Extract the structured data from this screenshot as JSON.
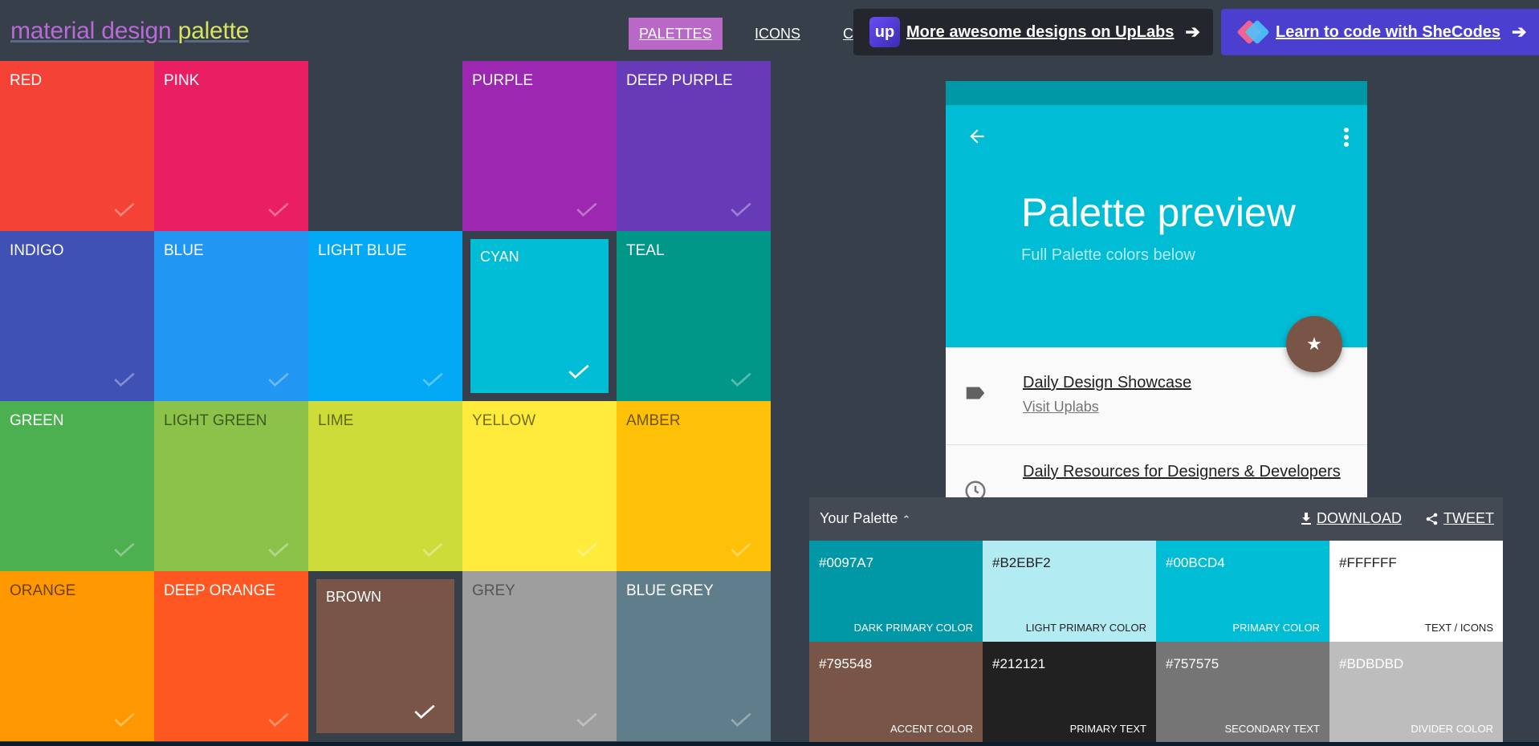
{
  "header": {
    "logo_part1": "material design",
    "logo_part2": "palette",
    "nav": [
      "PALETTES",
      "ICONS",
      "COLORS"
    ],
    "ads": {
      "uplabs_logo": "up",
      "uplabs_text": "More awesome designs on UpLabs",
      "shecodes_text": "Learn to code with SheCodes"
    }
  },
  "colors": [
    {
      "name": "RED",
      "bg": "#f44336",
      "text": "#ffffff",
      "selected": false
    },
    {
      "name": "PINK",
      "bg": "#e91e63",
      "text": "#ffffff",
      "selected": false
    },
    {
      "name": "",
      "bg": "#37404a",
      "text": "#ffffff",
      "selected": false,
      "empty": true
    },
    {
      "name": "PURPLE",
      "bg": "#9c27b0",
      "text": "#ffffff",
      "selected": false
    },
    {
      "name": "DEEP PURPLE",
      "bg": "#673ab7",
      "text": "#ffffff",
      "selected": false
    },
    {
      "name": "INDIGO",
      "bg": "#3f51b5",
      "text": "#ffffff",
      "selected": false
    },
    {
      "name": "BLUE",
      "bg": "#2196f3",
      "text": "#ffffff",
      "selected": false
    },
    {
      "name": "LIGHT BLUE",
      "bg": "#03a9f4",
      "text": "#ffffff",
      "selected": false
    },
    {
      "name": "CYAN",
      "bg": "#00bcd4",
      "text": "#ffffff",
      "selected": true
    },
    {
      "name": "TEAL",
      "bg": "#009688",
      "text": "#ffffff",
      "selected": false
    },
    {
      "name": "GREEN",
      "bg": "#4caf50",
      "text": "#ffffff",
      "selected": false
    },
    {
      "name": "LIGHT GREEN",
      "bg": "#8bc34a",
      "text": "#3d5a1f",
      "selected": false
    },
    {
      "name": "LIME",
      "bg": "#cddc39",
      "text": "#5f6a12",
      "selected": false
    },
    {
      "name": "YELLOW",
      "bg": "#ffeb3b",
      "text": "#776d1c",
      "selected": false
    },
    {
      "name": "AMBER",
      "bg": "#ffc107",
      "text": "#6e5400",
      "selected": false
    },
    {
      "name": "ORANGE",
      "bg": "#ff9800",
      "text": "#6a3f00",
      "selected": false
    },
    {
      "name": "DEEP ORANGE",
      "bg": "#ff5722",
      "text": "#ffffff",
      "selected": false
    },
    {
      "name": "BROWN",
      "bg": "#795548",
      "text": "#ffffff",
      "selected": true
    },
    {
      "name": "GREY",
      "bg": "#9e9e9e",
      "text": "#555555",
      "selected": false
    },
    {
      "name": "BLUE GREY",
      "bg": "#607d8b",
      "text": "#ffffff",
      "selected": false
    }
  ],
  "preview": {
    "title": "Palette preview",
    "subtitle": "Full Palette colors below",
    "items": [
      {
        "title": "Daily Design Showcase",
        "subtitle": "Visit Uplabs",
        "icon": "label-icon"
      },
      {
        "title": "Daily Resources for Designers & Developers",
        "subtitle": "",
        "icon": "clock-icon"
      }
    ],
    "fab_icon": "★"
  },
  "palette": {
    "title": "Your Palette",
    "download": "DOWNLOAD",
    "tweet": "TWEET",
    "swatches": [
      {
        "hex": "#0097A7",
        "name": "DARK PRIMARY COLOR",
        "bg": "#0097a7",
        "fg": "#ffffff"
      },
      {
        "hex": "#B2EBF2",
        "name": "LIGHT PRIMARY COLOR",
        "bg": "#b2ebf2",
        "fg": "#212121"
      },
      {
        "hex": "#00BCD4",
        "name": "PRIMARY COLOR",
        "bg": "#00bcd4",
        "fg": "#ffffff"
      },
      {
        "hex": "#FFFFFF",
        "name": "TEXT / ICONS",
        "bg": "#ffffff",
        "fg": "#212121"
      },
      {
        "hex": "#795548",
        "name": "ACCENT COLOR",
        "bg": "#795548",
        "fg": "#ffffff"
      },
      {
        "hex": "#212121",
        "name": "PRIMARY TEXT",
        "bg": "#212121",
        "fg": "#ffffff"
      },
      {
        "hex": "#757575",
        "name": "SECONDARY TEXT",
        "bg": "#757575",
        "fg": "#ffffff"
      },
      {
        "hex": "#BDBDBD",
        "name": "DIVIDER COLOR",
        "bg": "#bdbdbd",
        "fg": "#ffffff"
      }
    ]
  }
}
